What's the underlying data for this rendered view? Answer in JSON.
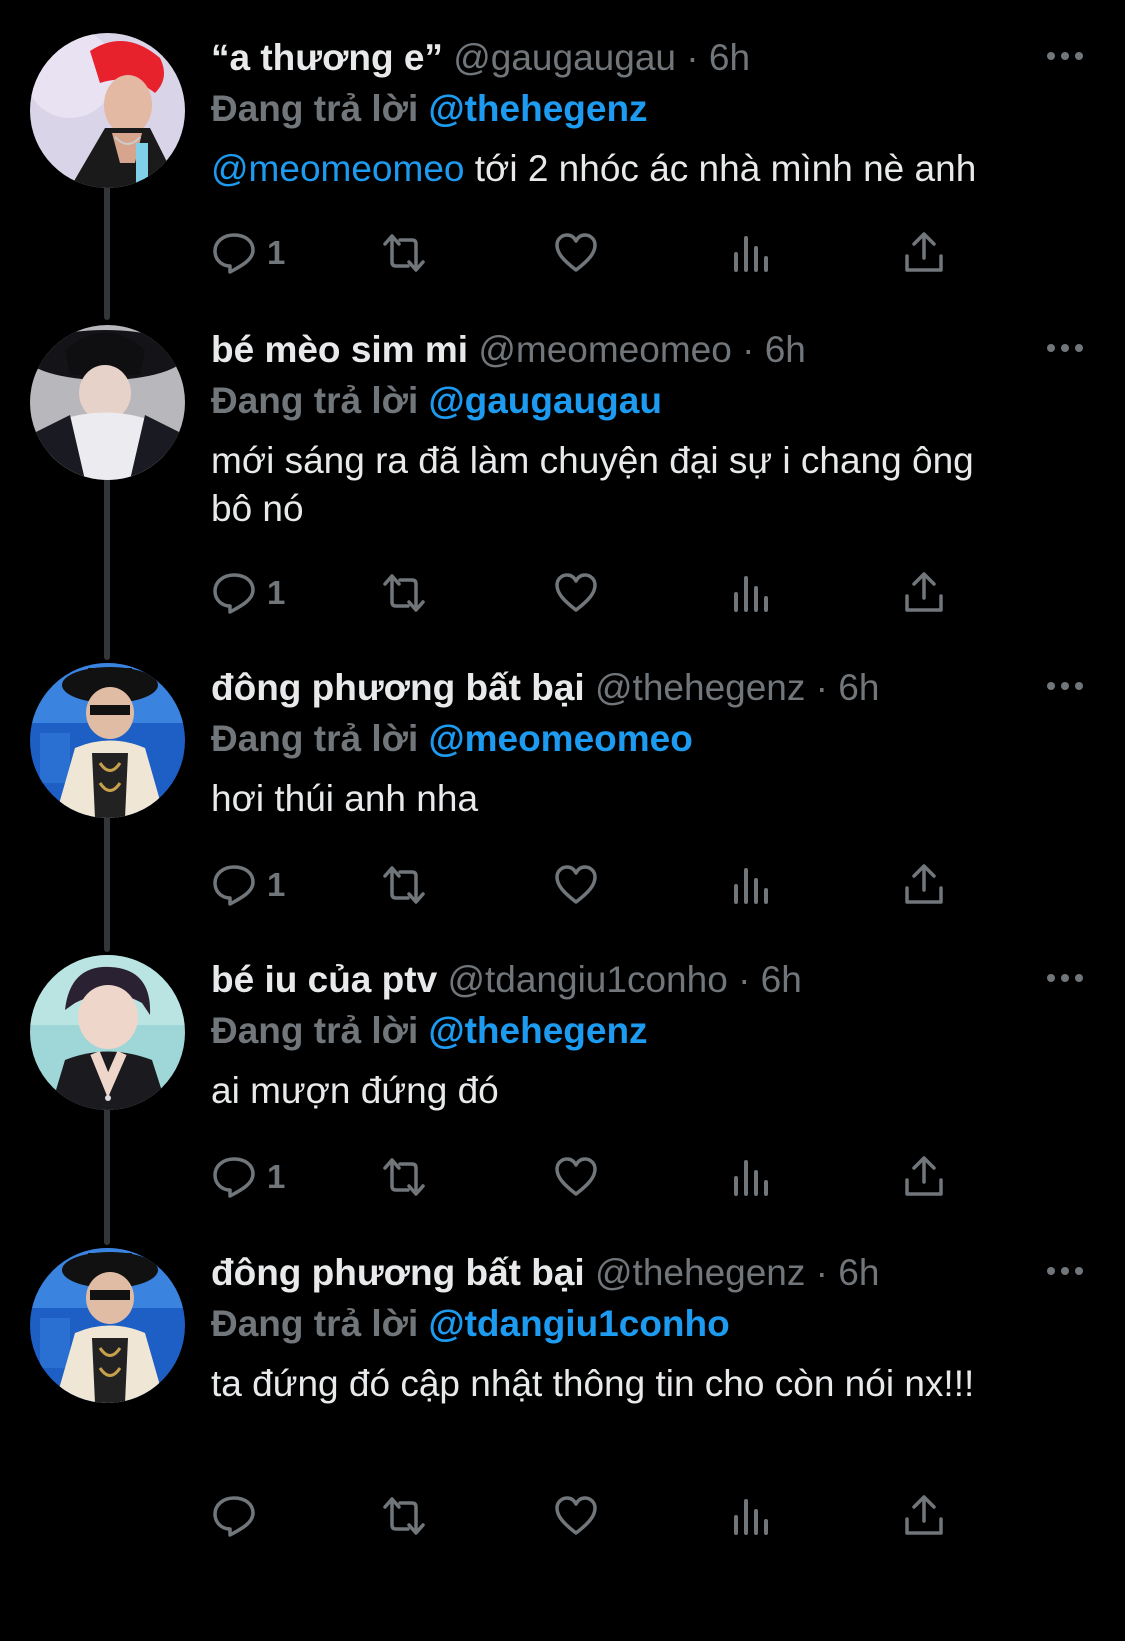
{
  "colors": {
    "background": "#000000",
    "text": "#e7e9ea",
    "muted": "#71767b",
    "link": "#1d9bf0",
    "thread_line": "#333639"
  },
  "icons": {
    "more": "more-icon",
    "reply": "reply-icon",
    "retweet": "retweet-icon",
    "like": "like-icon",
    "views": "views-icon",
    "share": "share-icon"
  },
  "tweets": [
    {
      "display_name": "“a thương e”",
      "handle": "@gaugaugau",
      "separator": "·",
      "time": "6h",
      "reply_label": "Đang trả lời",
      "reply_to": "@thehegenz",
      "text_mention": "@meomeomeo",
      "text": " tới 2 nhóc ác nhà mình nè anh",
      "reply_count": "1"
    },
    {
      "display_name": "bé mèo sim mi",
      "handle": "@meomeomeo",
      "separator": "·",
      "time": "6h",
      "reply_label": "Đang trả lời",
      "reply_to": "@gaugaugau",
      "text_mention": "",
      "text": "mới sáng ra đã làm chuyện đại sự i chang ông bô nó",
      "reply_count": "1"
    },
    {
      "display_name": "đông phương bất bại",
      "handle": "@thehegenz",
      "separator": "·",
      "time": "6h",
      "reply_label": "Đang trả lời",
      "reply_to": "@meomeomeo",
      "text_mention": "",
      "text": "hơi thúi anh nha",
      "reply_count": "1"
    },
    {
      "display_name": "bé iu của ptv",
      "handle": "@tdangiu1conho",
      "separator": "·",
      "time": "6h",
      "reply_label": "Đang trả lời",
      "reply_to": "@thehegenz",
      "text_mention": "",
      "text": "ai mượn đứng đó",
      "reply_count": "1"
    },
    {
      "display_name": "đông phương bất bại",
      "handle": "@thehegenz",
      "separator": "·",
      "time": "6h",
      "reply_label": "Đang trả lời",
      "reply_to": "@tdangiu1conho",
      "text_mention": "",
      "text": "ta đứng đó cập nhật thông tin cho còn nói nx!!!",
      "reply_count": ""
    }
  ]
}
